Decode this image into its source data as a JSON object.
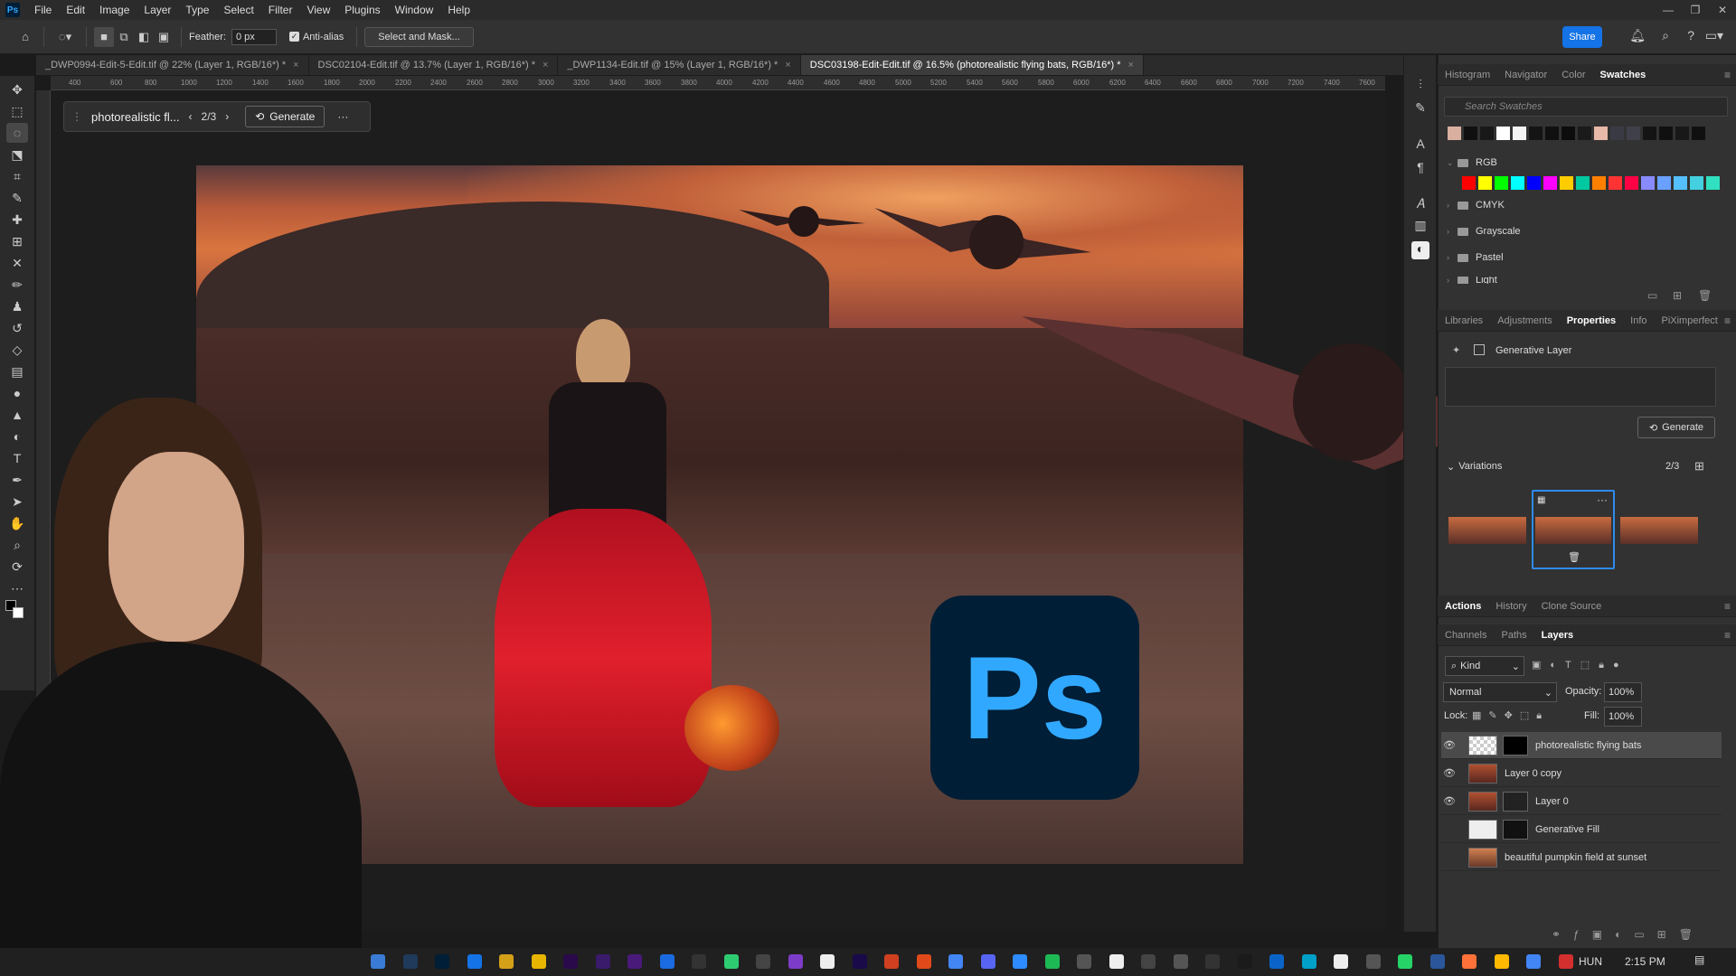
{
  "menubar": {
    "app_icon": "Ps",
    "items": [
      "File",
      "Edit",
      "Image",
      "Layer",
      "Type",
      "Select",
      "Filter",
      "View",
      "Plugins",
      "Window",
      "Help"
    ]
  },
  "options": {
    "feather_label": "Feather:",
    "feather_value": "0 px",
    "antialias_label": "Anti-alias",
    "select_mask_label": "Select and Mask...",
    "share_label": "Share"
  },
  "tabs": [
    {
      "label": "_DWP0994-Edit-5-Edit.tif @ 22% (Layer 1, RGB/16*) *",
      "active": false
    },
    {
      "label": "DSC02104-Edit.tif @ 13.7% (Layer 1, RGB/16*) *",
      "active": false
    },
    {
      "label": "_DWP1134-Edit.tif @ 15% (Layer 1, RGB/16*) *",
      "active": false
    },
    {
      "label": "DSC03198-Edit-Edit.tif @ 16.5% (photorealistic flying bats, RGB/16*) *",
      "active": true
    }
  ],
  "ruler_ticks": [
    "400",
    "600",
    "800",
    "1000",
    "1200",
    "1400",
    "1600",
    "1800",
    "2000",
    "2200",
    "2400",
    "2600",
    "2800",
    "3000",
    "3200",
    "3400",
    "3600",
    "3800",
    "4000",
    "4200",
    "4400",
    "4600",
    "4800",
    "5000",
    "5200",
    "5400",
    "5600",
    "5800",
    "6000",
    "6200",
    "6400",
    "6600",
    "6800",
    "7000",
    "7200",
    "7400",
    "7600",
    "7800"
  ],
  "context_bar": {
    "prompt": "photorealistic fl...",
    "counter": "2/3",
    "generate_label": "Generate"
  },
  "panels": {
    "top_tabs": [
      "Histogram",
      "Navigator",
      "Color",
      "Swatches"
    ],
    "top_active": "Swatches",
    "swatch_search_placeholder": "Search Swatches",
    "recent_swatches": [
      "#d9b0a0",
      "#101010",
      "#181818",
      "#ffffff",
      "#f4f4f4",
      "#141414",
      "#101010",
      "#0c0c0c",
      "#1a1a1a",
      "#e8b8a8",
      "#3a3a44",
      "#40404a",
      "#141414",
      "#101010",
      "#181818",
      "#101010"
    ],
    "rgb_swatches": [
      "#ff0000",
      "#ffff00",
      "#00ff00",
      "#00ffff",
      "#0000ff",
      "#ff00ff",
      "#ffcc00",
      "#00c8a0",
      "#ff8000",
      "#ff3333",
      "#ff0044",
      "#8a8aff",
      "#6aa0ff",
      "#55c0ff",
      "#44d0e0",
      "#30e0c0"
    ],
    "swatch_folders": [
      "RGB",
      "CMYK",
      "Grayscale",
      "Pastel",
      "Light"
    ],
    "mid_tabs": [
      "Libraries",
      "Adjustments",
      "Properties",
      "Info",
      "PiXimperfect"
    ],
    "mid_active": "Properties",
    "properties_title": "Generative Layer",
    "properties_generate": "Generate",
    "variations_label": "Variations",
    "variations_counter": "2/3",
    "actions_tabs": [
      "Actions",
      "History",
      "Clone Source"
    ],
    "layers_tabs": [
      "Channels",
      "Paths",
      "Layers"
    ],
    "layers_active": "Layers",
    "kind_label": "Kind",
    "blend_mode": "Normal",
    "opacity_label": "Opacity:",
    "opacity_value": "100%",
    "lock_label": "Lock:",
    "fill_label": "Fill:",
    "fill_value": "100%",
    "layers": [
      {
        "name": "photorealistic flying bats",
        "visible": true,
        "selected": true
      },
      {
        "name": "Layer 0 copy",
        "visible": true,
        "selected": false
      },
      {
        "name": "Layer 0",
        "visible": true,
        "selected": false
      },
      {
        "name": "Generative Fill",
        "visible": false,
        "selected": false
      },
      {
        "name": "beautiful pumpkin field at sunset",
        "visible": false,
        "selected": false
      }
    ]
  },
  "ps_logo_text": "Ps",
  "taskbar": {
    "language": "HUN",
    "time": "2:15 PM"
  }
}
